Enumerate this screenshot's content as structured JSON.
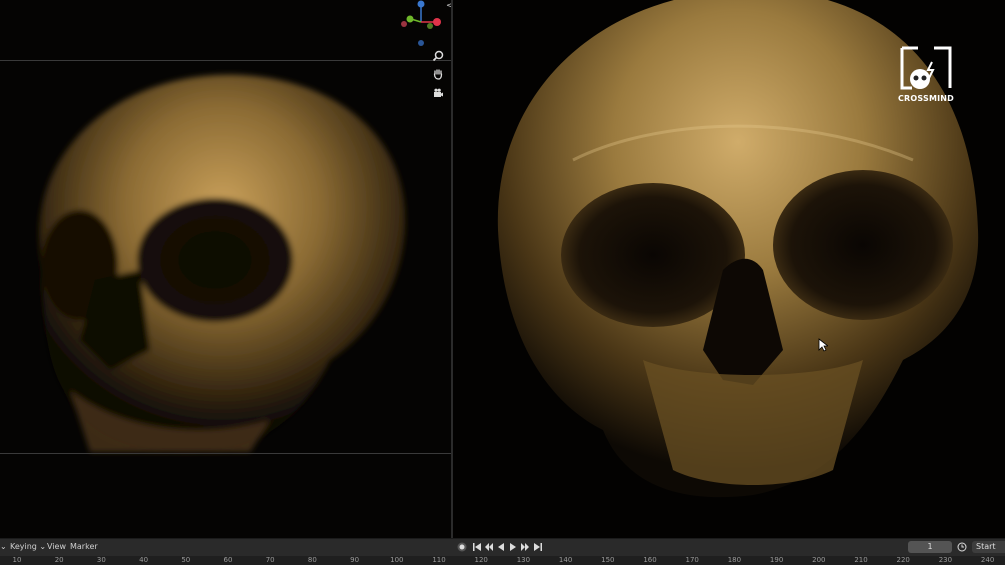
{
  "viewport_left": {
    "gizmo": {
      "x_label": "",
      "y_label": "",
      "z_label": ""
    },
    "nav_icons": [
      "zoom-icon",
      "hand-pan-icon",
      "camera-icon"
    ]
  },
  "viewport_right": {
    "logo": {
      "text": "CROSSMIND"
    }
  },
  "timeline": {
    "menu": {
      "keying": "Keying",
      "view": "View",
      "marker": "Marker"
    },
    "current_frame": "1",
    "start_label": "Start",
    "ruler_ticks": [
      "10",
      "20",
      "30",
      "40",
      "50",
      "60",
      "70",
      "80",
      "90",
      "100",
      "110",
      "120",
      "130",
      "140",
      "150",
      "160",
      "170",
      "180",
      "190",
      "200",
      "210",
      "220",
      "230",
      "240"
    ]
  },
  "colors": {
    "accent_x": "#e0344a",
    "accent_y": "#6fb82a",
    "accent_z": "#3a78cf"
  }
}
